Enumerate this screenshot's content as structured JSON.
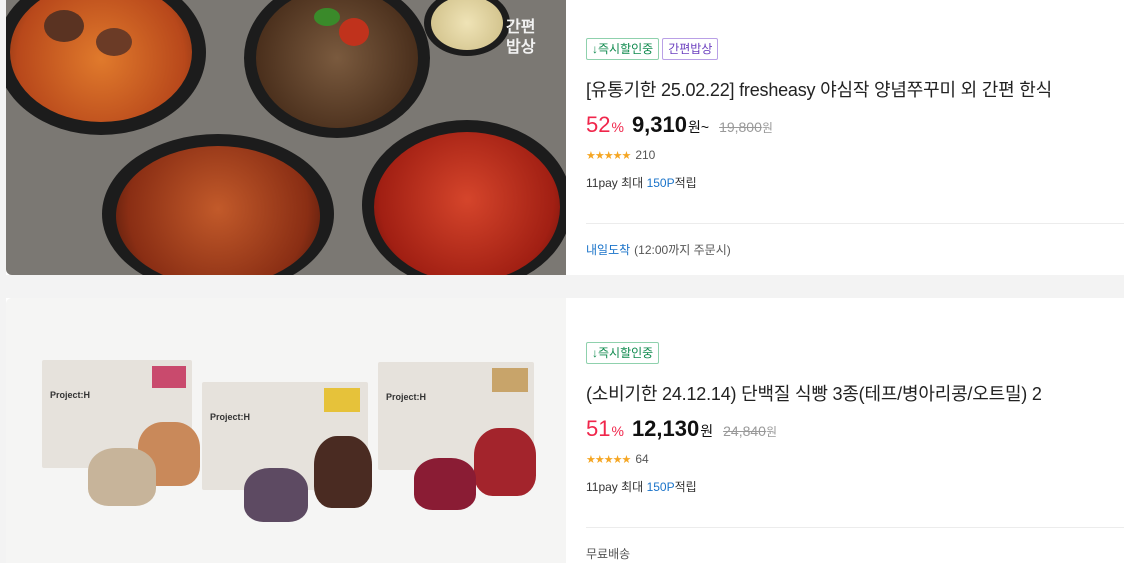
{
  "products": [
    {
      "badges": [
        {
          "label": "↓즉시할인중",
          "style": "green"
        },
        {
          "label": "간편밥상",
          "style": "purple"
        }
      ],
      "image_watermark": [
        "간편",
        "밥상"
      ],
      "title": "[유통기한 25.02.22] fresheasy 야심작 양념쭈꾸미 외 간편 한식",
      "discount": "52",
      "discount_unit": "%",
      "price": "9,310",
      "price_unit": "원~",
      "original_price": "19,800",
      "original_unit": "원",
      "rating_count": "210",
      "point_prefix": "11pay 최대 ",
      "point_value": "150P",
      "point_suffix": "적립",
      "delivery_strong": "내일도착",
      "delivery_note": "(12:00까지 주문시)"
    },
    {
      "badges": [
        {
          "label": "↓즉시할인중",
          "style": "green"
        }
      ],
      "title": "(소비기한 24.12.14) 단백질 식빵 3종(테프/병아리콩/오트밀) 2",
      "discount": "51",
      "discount_unit": "%",
      "price": "12,130",
      "price_unit": "원",
      "original_price": "24,840",
      "original_unit": "원",
      "rating_count": "64",
      "point_prefix": "11pay 최대 ",
      "point_value": "150P",
      "point_suffix": "적립",
      "delivery_note": "무료배송"
    }
  ],
  "ratings": {
    "stars": "★★★★★",
    "rating_value": 4.5,
    "star_color": "#f5a623"
  },
  "colors": {
    "discount": "#f0264b",
    "point": "#1a73c9",
    "badge_green": "#0f8a4e",
    "badge_purple": "#6b3fbf"
  },
  "bread_labels": [
    "Project:H",
    "Project:H",
    "Project:H"
  ]
}
